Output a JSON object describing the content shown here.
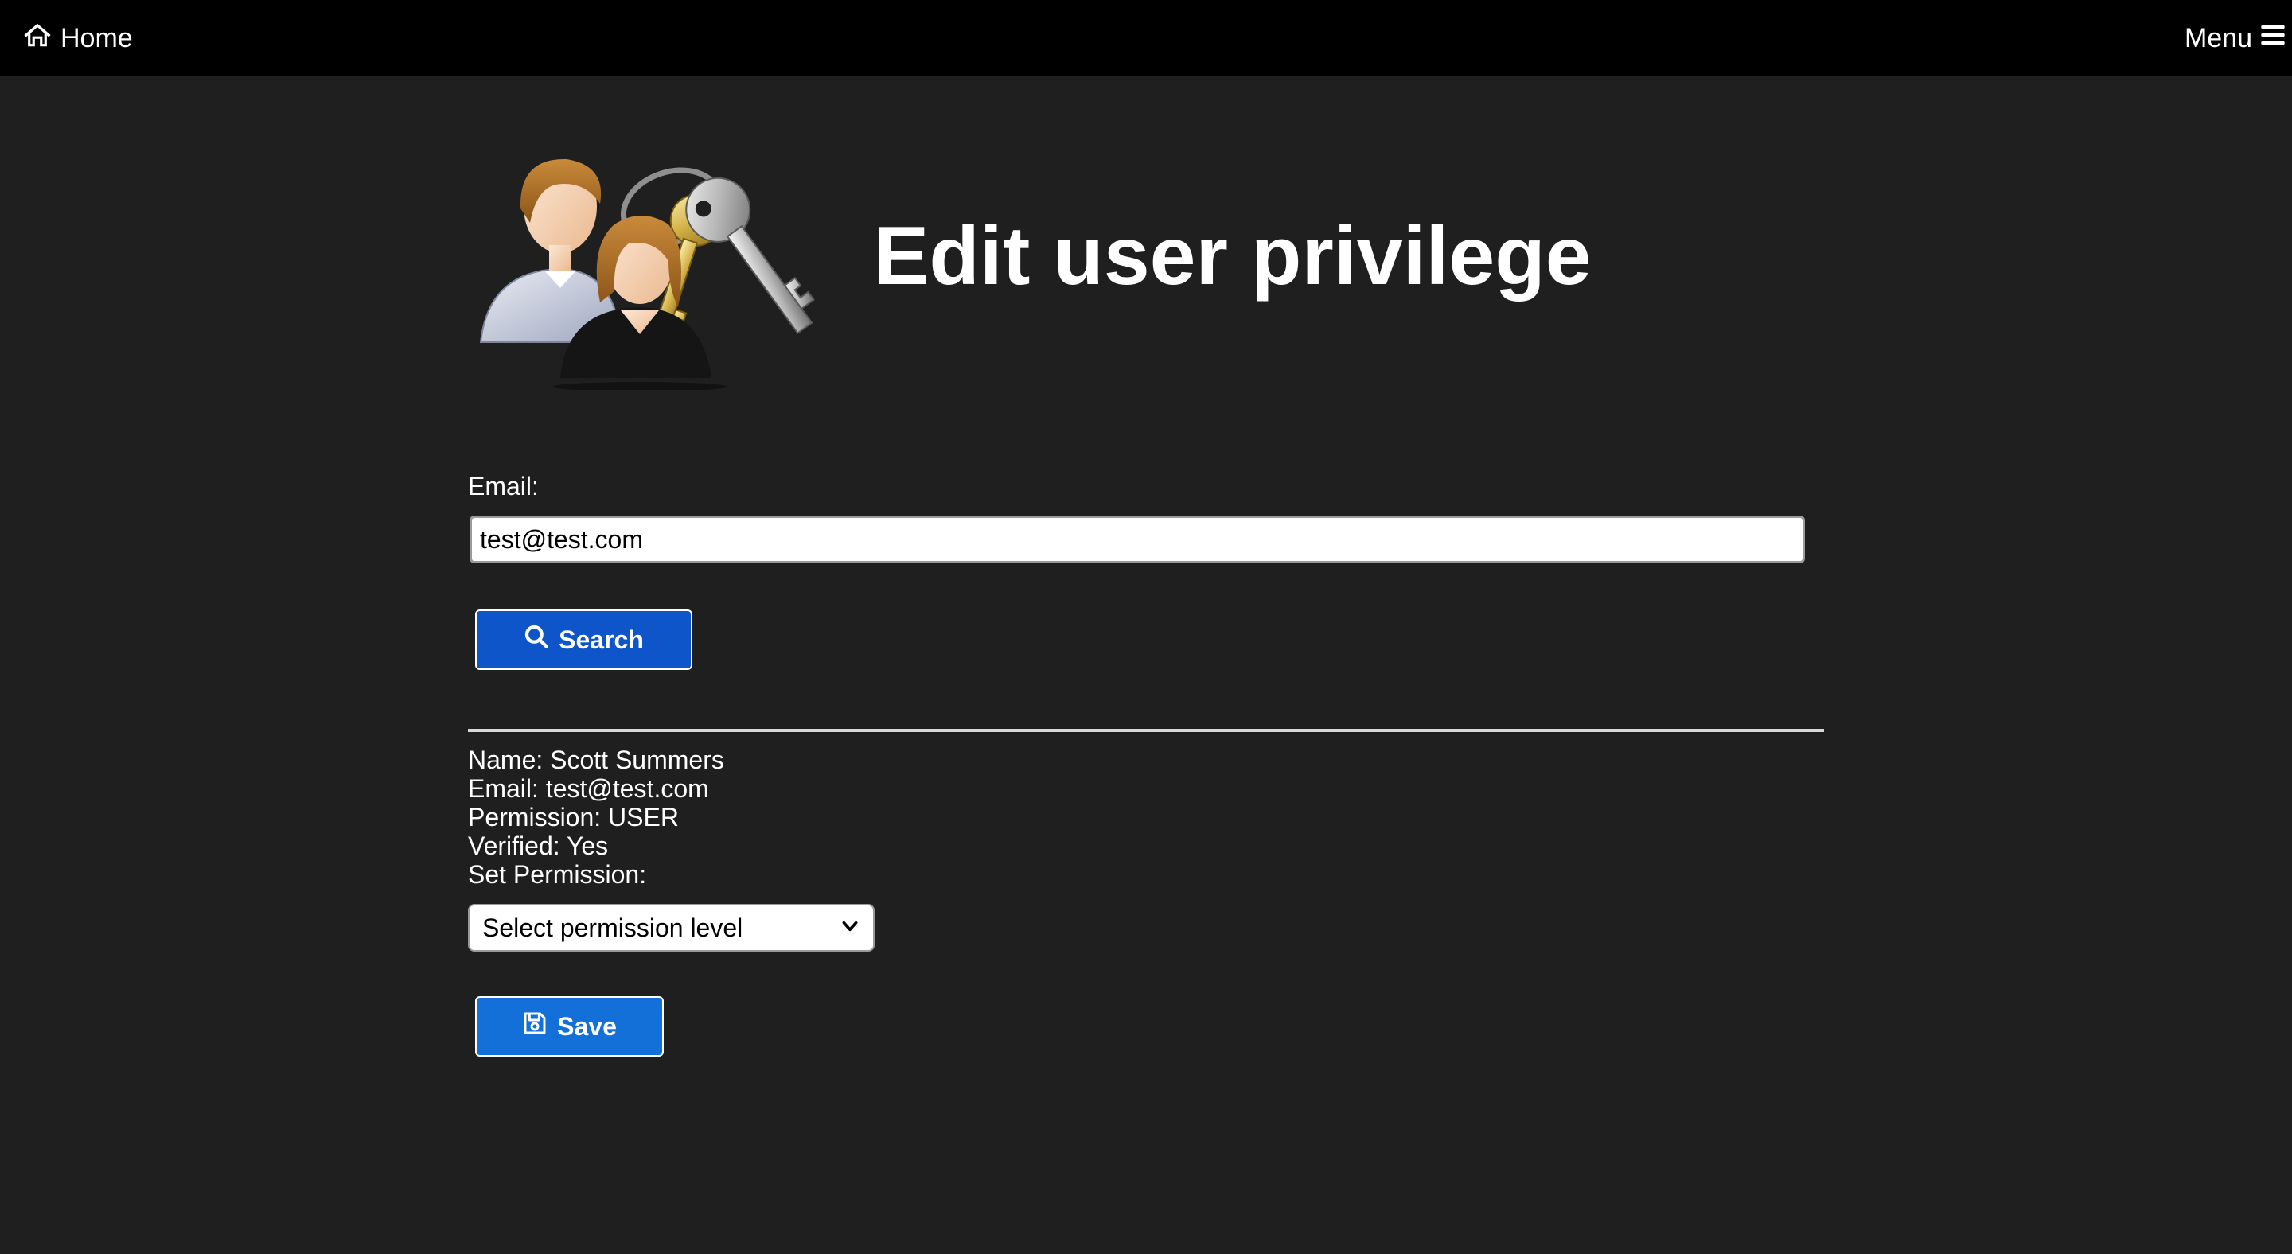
{
  "nav": {
    "home_label": "Home",
    "menu_label": "Menu"
  },
  "header": {
    "title": "Edit user privilege",
    "illustration": "users-with-keys-icon"
  },
  "search": {
    "email_label": "Email:",
    "email_value": "test@test.com",
    "search_button_label": "Search",
    "search_icon": "magnifier-icon"
  },
  "user": {
    "name_line": "Name: Scott Summers",
    "email_line": "Email: test@test.com",
    "permission_line": "Permission: USER",
    "verified_line": "Verified: Yes",
    "set_permission_label": "Set Permission:"
  },
  "permission_select": {
    "selected": "Select permission level"
  },
  "save": {
    "label": "Save",
    "icon": "floppy-disk-icon"
  },
  "colors": {
    "page_background": "#1f1f1f",
    "topbar_background": "#000000",
    "search_button": "#0d55c8",
    "save_button": "#1470d9"
  }
}
